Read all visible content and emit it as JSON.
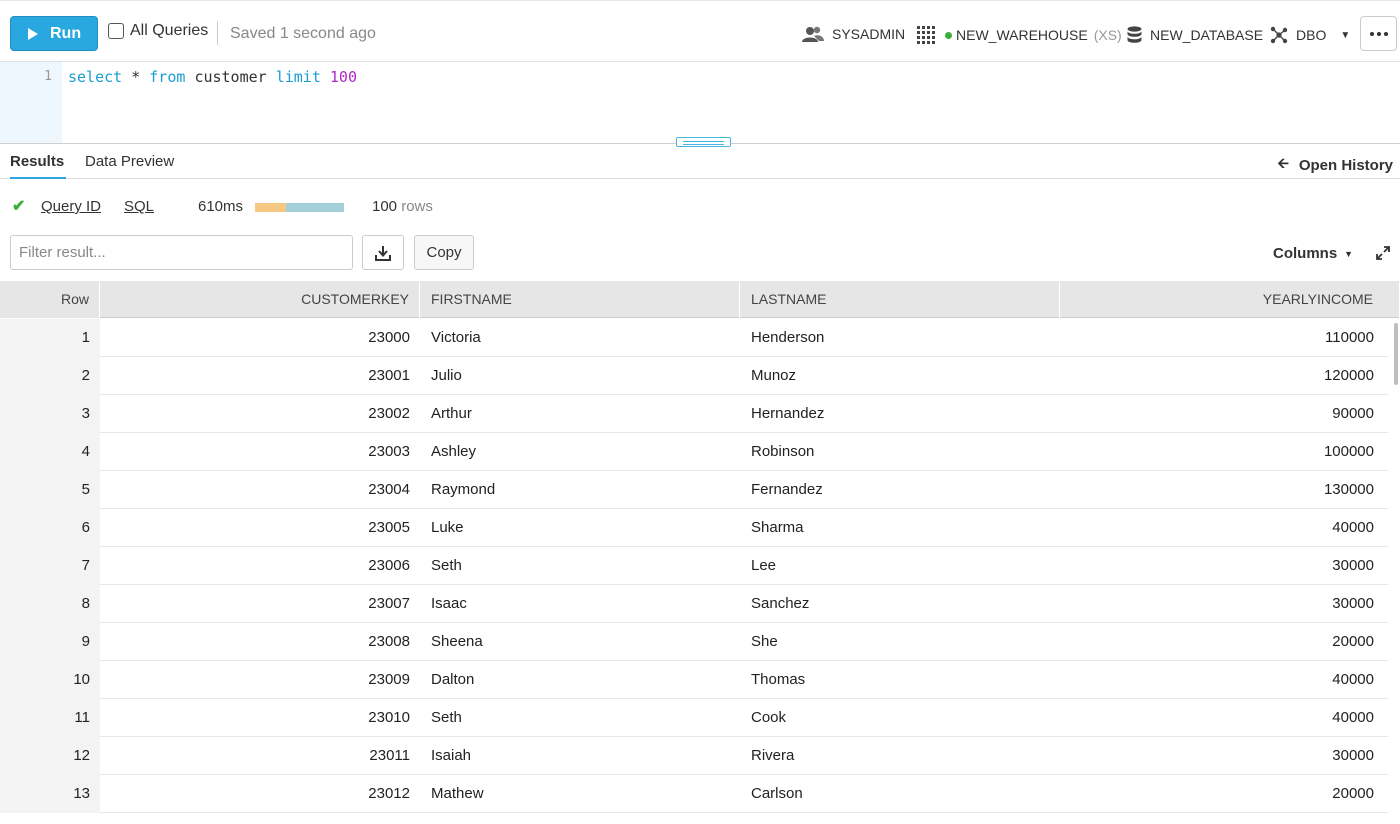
{
  "toolbar": {
    "run_label": "Run",
    "all_queries_label": "All Queries",
    "saved_status": "Saved 1 second ago",
    "role": "SYSADMIN",
    "warehouse": "NEW_WAREHOUSE",
    "warehouse_size": "(XS)",
    "database": "NEW_DATABASE",
    "schema": "DBO"
  },
  "editor": {
    "line_number": "1",
    "kw_select": "select",
    "star": "*",
    "kw_from": "from",
    "table": "customer",
    "kw_limit": "limit",
    "limit_value": "100"
  },
  "tabs": {
    "results": "Results",
    "data_preview": "Data Preview",
    "open_history": "Open History"
  },
  "query_info": {
    "query_id_label": "Query ID",
    "sql_label": "SQL",
    "duration": "610ms",
    "duration_fraction_compile": 0.35,
    "row_count": "100",
    "rows_label": "rows"
  },
  "results_toolbar": {
    "filter_placeholder": "Filter result...",
    "copy_label": "Copy",
    "columns_label": "Columns"
  },
  "table": {
    "headers": [
      "Row",
      "CUSTOMERKEY",
      "FIRSTNAME",
      "LASTNAME",
      "YEARLYINCOME"
    ],
    "rows": [
      [
        "1",
        "23000",
        "Victoria",
        "Henderson",
        "110000"
      ],
      [
        "2",
        "23001",
        "Julio",
        "Munoz",
        "120000"
      ],
      [
        "3",
        "23002",
        "Arthur",
        "Hernandez",
        "90000"
      ],
      [
        "4",
        "23003",
        "Ashley",
        "Robinson",
        "100000"
      ],
      [
        "5",
        "23004",
        "Raymond",
        "Fernandez",
        "130000"
      ],
      [
        "6",
        "23005",
        "Luke",
        "Sharma",
        "40000"
      ],
      [
        "7",
        "23006",
        "Seth",
        "Lee",
        "30000"
      ],
      [
        "8",
        "23007",
        "Isaac",
        "Sanchez",
        "30000"
      ],
      [
        "9",
        "23008",
        "Sheena",
        "She",
        "20000"
      ],
      [
        "10",
        "23009",
        "Dalton",
        "Thomas",
        "40000"
      ],
      [
        "11",
        "23010",
        "Seth",
        "Cook",
        "40000"
      ],
      [
        "12",
        "23011",
        "Isaiah",
        "Rivera",
        "30000"
      ],
      [
        "13",
        "23012",
        "Mathew",
        "Carlson",
        "20000"
      ]
    ]
  }
}
